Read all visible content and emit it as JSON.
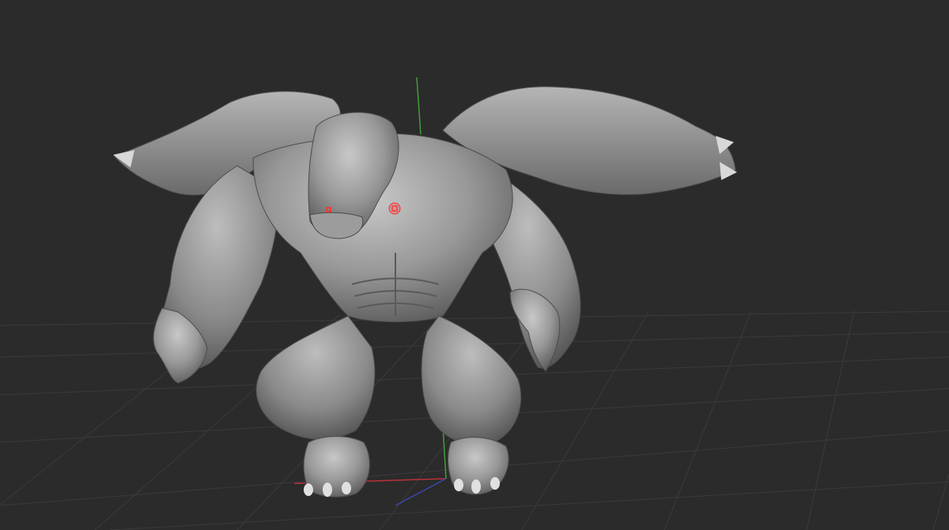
{
  "viewport": {
    "background_color": "#2b2b2b",
    "grid_color": "#3d3d3d",
    "model_color": "#8f8f8f",
    "model_highlight_color": "#c4c4c4",
    "model_shadow_color": "#4a4a4a",
    "axis_x_color": "#b8323a",
    "axis_y_color": "#3fa03a",
    "axis_z_color": "#3a48a6",
    "selection_marker_color": "#ff2a2a"
  },
  "model": {
    "icon": "sculpt-mesh-icon"
  }
}
